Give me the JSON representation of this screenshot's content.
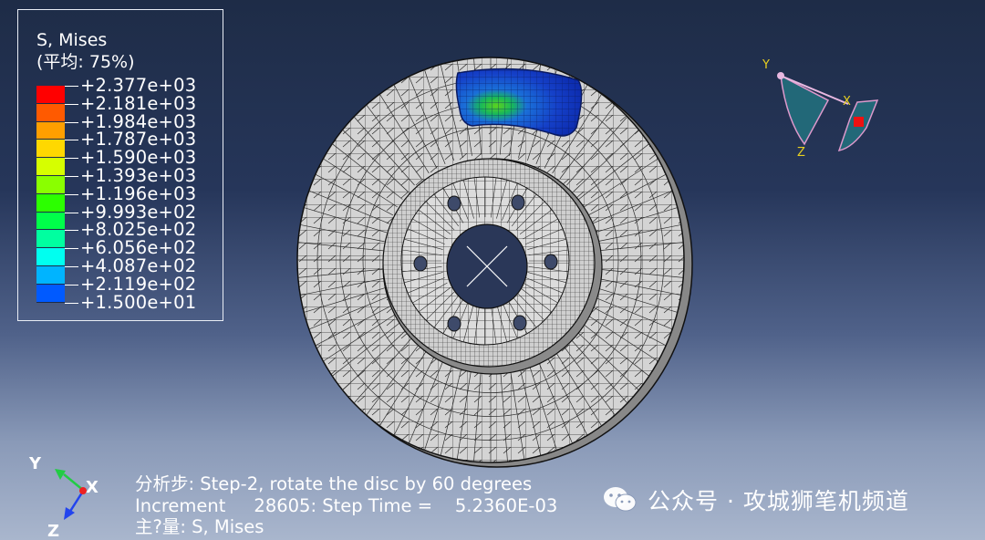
{
  "legend": {
    "title": "S, Mises",
    "subtitle": "(平均: 75%)",
    "entries": [
      {
        "label": "+2.377e+03",
        "color": "#ff0000"
      },
      {
        "label": "+2.181e+03",
        "color": "#ff5a00"
      },
      {
        "label": "+1.984e+03",
        "color": "#ff9f00"
      },
      {
        "label": "+1.787e+03",
        "color": "#ffd800"
      },
      {
        "label": "+1.590e+03",
        "color": "#d6ff00"
      },
      {
        "label": "+1.393e+03",
        "color": "#8aff00"
      },
      {
        "label": "+1.196e+03",
        "color": "#2cff00"
      },
      {
        "label": "+9.993e+02",
        "color": "#00ff4a"
      },
      {
        "label": "+8.025e+02",
        "color": "#00ffa0"
      },
      {
        "label": "+6.056e+02",
        "color": "#00fff0"
      },
      {
        "label": "+4.087e+02",
        "color": "#00b4ff"
      },
      {
        "label": "+2.119e+02",
        "color": "#005aff"
      },
      {
        "label": "+1.500e+01",
        "color": "#0000ff"
      }
    ]
  },
  "triad_top": {
    "x": "X",
    "y": "Y",
    "z": "Z"
  },
  "triad_bottom": {
    "x": "X",
    "y": "Y",
    "z": "Z"
  },
  "info": {
    "line1": "分析步: Step-2, rotate the disc by 60 degrees",
    "line2": "Increment     28605: Step Time =    5.2360E-03",
    "line3": "主?量: S, Mises"
  },
  "watermark": {
    "text": "公众号 · 攻城狮笔机频道",
    "icon": "wechat-icon"
  },
  "colors": {
    "background_top": "#1e2c47",
    "background_bottom": "#a9b6cd",
    "mesh_fill": "#dcdcdc",
    "mesh_line": "#2a2a2a",
    "pad_stress_low": "#1030c8"
  }
}
